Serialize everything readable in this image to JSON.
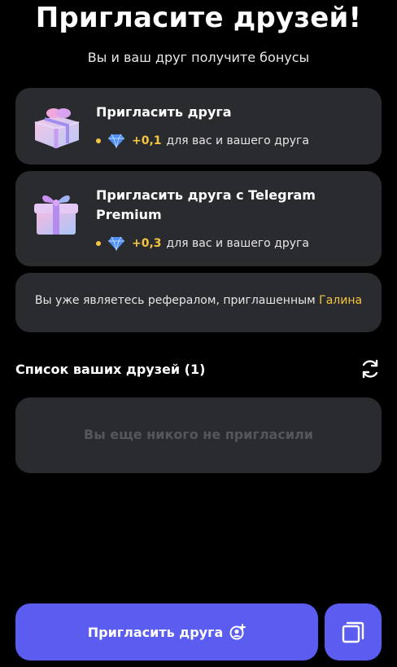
{
  "header": {
    "title": "Пригласите друзей!",
    "subtitle": "Вы и ваш друг получите бонусы"
  },
  "invite_options": [
    {
      "title": "Пригласить друга",
      "icon": "gift-icon",
      "bonus_value": "+0,1",
      "bonus_text": "для вас и вашего друга"
    },
    {
      "title": "Пригласить друга с Telegram Premium",
      "icon": "gift-icon",
      "bonus_value": "+0,3",
      "bonus_text": "для вас и вашего друга"
    }
  ],
  "referral": {
    "text": "Вы уже являетесь рефералом, приглашенным",
    "inviter": "Галина"
  },
  "friends": {
    "title": "Список ваших друзей (1)",
    "empty_text": "Вы еще никого не пригласили",
    "refresh_icon": "refresh-icon"
  },
  "actions": {
    "invite_label": "Пригласить друга",
    "invite_icon": "add-user-icon",
    "copy_icon": "copy-icon"
  },
  "colors": {
    "accent": "#5b5cf0",
    "gold": "#f5c542",
    "card": "#2a2b2f",
    "background": "#000000"
  }
}
